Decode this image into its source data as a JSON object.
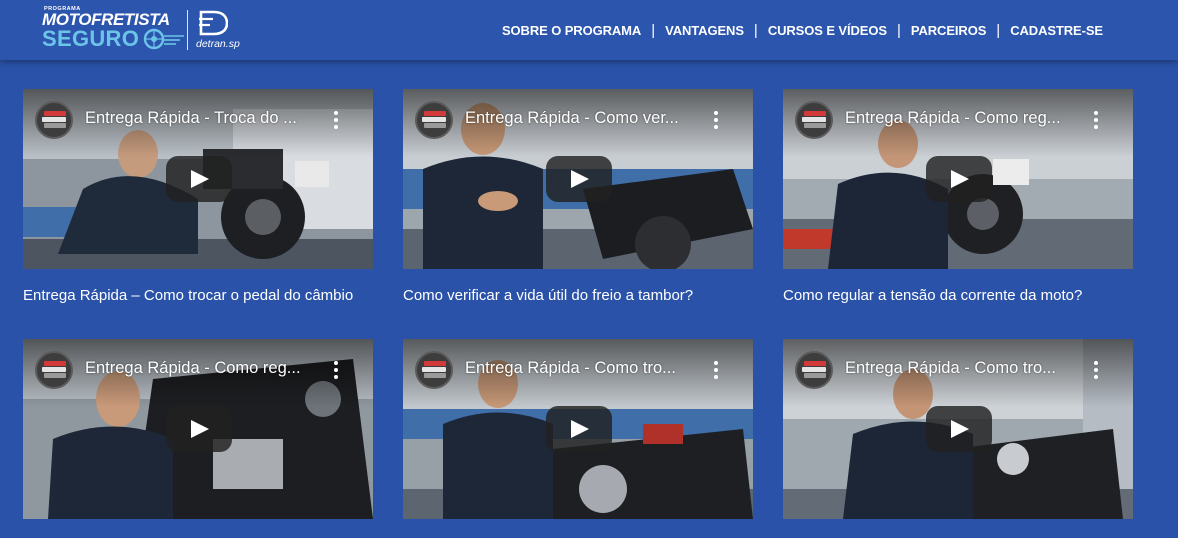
{
  "brand": {
    "program_label": "PROGRAMA",
    "name_line1": "MOTOFRETISTA",
    "name_line2": "SEGURO",
    "partner_name": "detran.sp"
  },
  "nav": {
    "items": [
      {
        "label": "SOBRE O PROGRAMA"
      },
      {
        "label": "VANTAGENS"
      },
      {
        "label": "CURSOS E VÍDEOS"
      },
      {
        "label": "PARCEIROS"
      },
      {
        "label": "CADASTRE-SE"
      }
    ],
    "separator": "|"
  },
  "colors": {
    "background": "#2a52a8",
    "header": "#2c55ad",
    "brand_accent": "#6cc4e8",
    "text": "#ffffff"
  },
  "videos": [
    {
      "overlay_title": "Entrega Rápida - Troca do ...",
      "caption": "Entrega Rápida – Como trocar o pedal do câmbio"
    },
    {
      "overlay_title": "Entrega Rápida - Como ver...",
      "caption": "Como verificar a vida útil do freio a tambor?"
    },
    {
      "overlay_title": "Entrega Rápida - Como reg...",
      "caption": "Como regular a tensão da corrente da moto?"
    },
    {
      "overlay_title": "Entrega Rápida - Como reg...",
      "caption": ""
    },
    {
      "overlay_title": "Entrega Rápida - Como tro...",
      "caption": ""
    },
    {
      "overlay_title": "Entrega Rápida - Como tro...",
      "caption": ""
    }
  ]
}
